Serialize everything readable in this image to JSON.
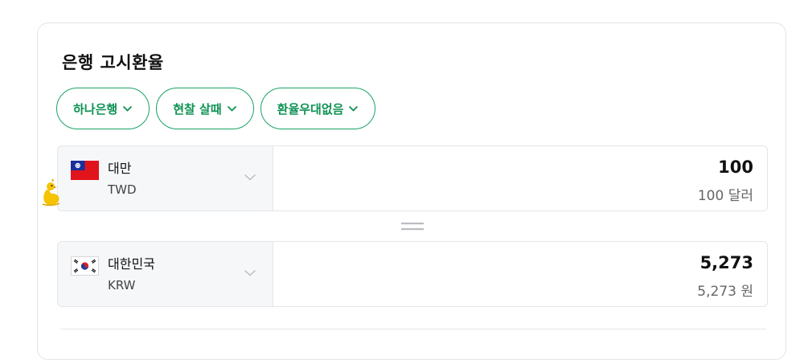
{
  "widget": {
    "title": "은행 고시환율"
  },
  "filters": [
    {
      "label": "하나은행"
    },
    {
      "label": "현찰 살때"
    },
    {
      "label": "환율우대없음"
    }
  ],
  "source": {
    "country": "대만",
    "code": "TWD",
    "amount": "100",
    "amount_text": "100 달러",
    "flag_icon": "taiwan-flag-icon"
  },
  "target": {
    "country": "대한민국",
    "code": "KRW",
    "amount": "5,273",
    "amount_text": "5,273 원",
    "flag_icon": "south-korea-flag-icon"
  },
  "colors": {
    "accent": "#19a363",
    "accent_text": "#0f9254"
  }
}
